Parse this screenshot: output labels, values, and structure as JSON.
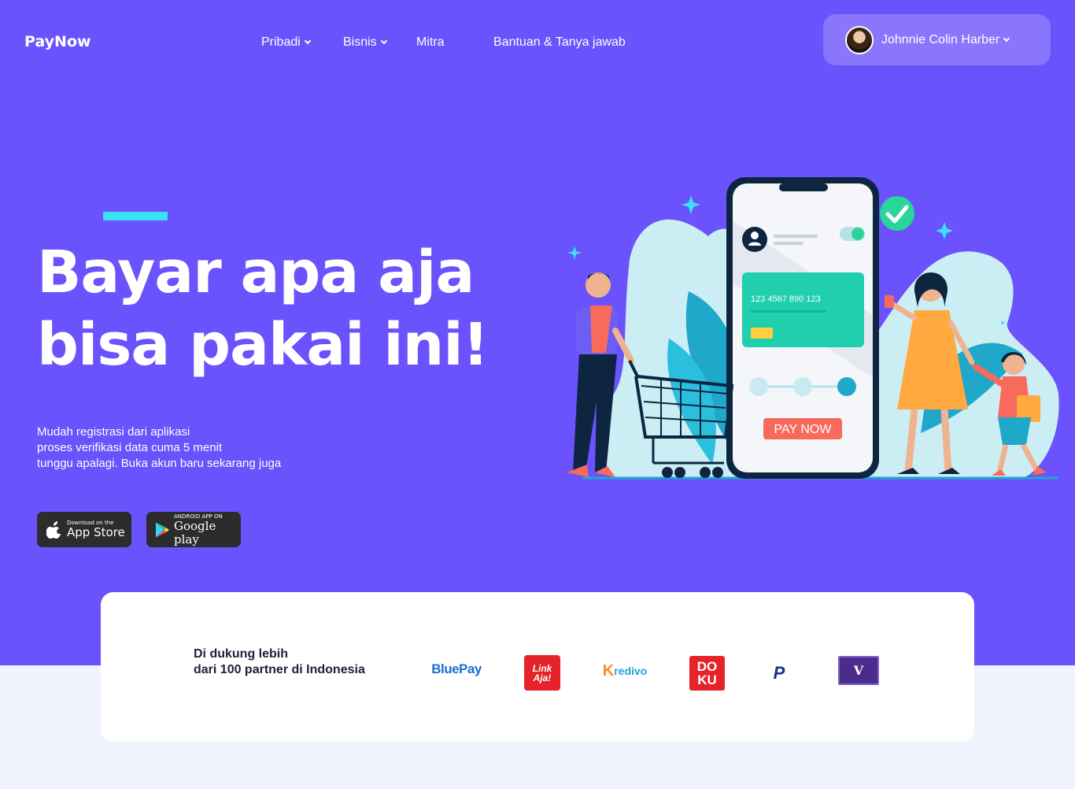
{
  "brand": {
    "name": "PayNow"
  },
  "nav": {
    "items": [
      {
        "label": "Pribadi",
        "has_dropdown": true
      },
      {
        "label": "Bisnis",
        "has_dropdown": true
      },
      {
        "label": "Mitra",
        "has_dropdown": false
      },
      {
        "label": "Bantuan & Tanya jawab",
        "has_dropdown": false
      }
    ]
  },
  "user": {
    "name": "Johnnie Colin Harber"
  },
  "hero": {
    "headline_line1": "Bayar apa aja",
    "headline_line2": "bisa pakai ini!",
    "subtext": [
      "Mudah registrasi dari aplikasi",
      "proses verifikasi data cuma 5 menit",
      "tunggu apalagi. Buka akun baru sekarang juga"
    ],
    "stores": {
      "appstore_small": "Download on the",
      "appstore_big": "App Store",
      "play_small": "ANDROID APP ON",
      "play_big": "Google play"
    }
  },
  "illustration": {
    "card_number": "123 4567 890 123",
    "pay_button": "PAY NOW"
  },
  "partners": {
    "line1": "Di dukung lebih",
    "line2": "dari 100 partner di Indonesia",
    "logos": {
      "bluepay": "BluePay",
      "linkaja_1": "Link",
      "linkaja_2": "Aja!",
      "kredivo": "redivo",
      "kredivo_k": "K",
      "doku_1": "DO",
      "doku_2": "KU",
      "paypal": "P",
      "v": "V"
    }
  },
  "colors": {
    "hero_bg": "#6a52fd",
    "accent": "#3de0f5",
    "page_bg": "#eff3fd"
  }
}
